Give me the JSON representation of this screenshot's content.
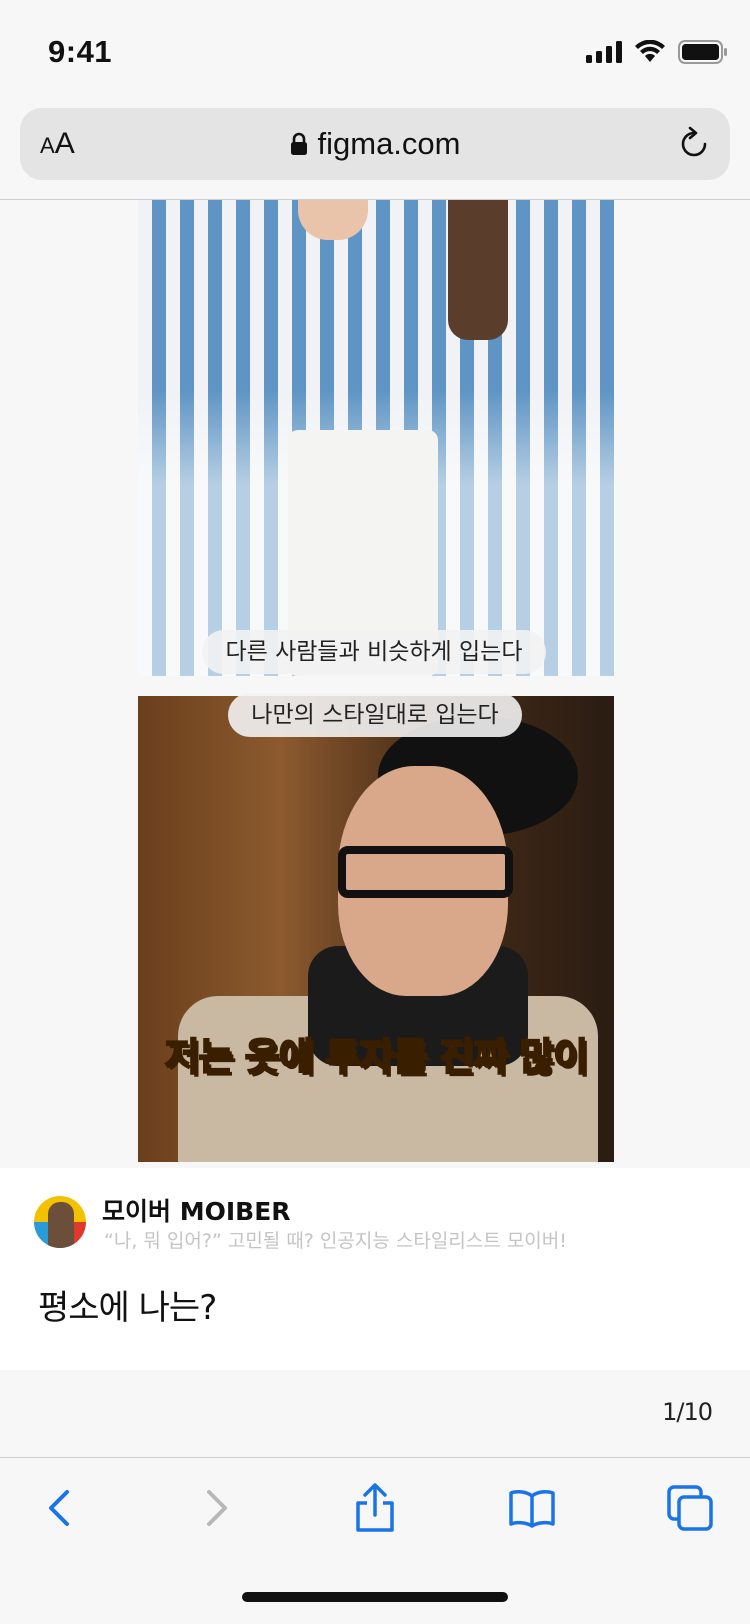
{
  "status_bar": {
    "time": "9:41"
  },
  "address_bar": {
    "text_size_label": "AA",
    "url": "figma.com"
  },
  "photos": [
    {
      "caption": "다른 사람들과 비슷하게 입는다"
    },
    {
      "caption": "나만의 스타일대로 입는다",
      "overlay_text": "저는 옷에 투자를 진짜 많이"
    }
  ],
  "card": {
    "account_name": "모이버 MOIBER",
    "account_description": "“나, 뭐 입어?” 고민될 때? 인공지능 스타일리스트 모이버!",
    "question": "평소에 나는?"
  },
  "pagination": {
    "current": "1/10"
  },
  "toolbar": {
    "icons": [
      "back-icon",
      "forward-icon",
      "share-icon",
      "bookmarks-icon",
      "tabs-icon"
    ],
    "accent_color": "#1a73e8",
    "disabled_color": "#b8b8b8"
  }
}
